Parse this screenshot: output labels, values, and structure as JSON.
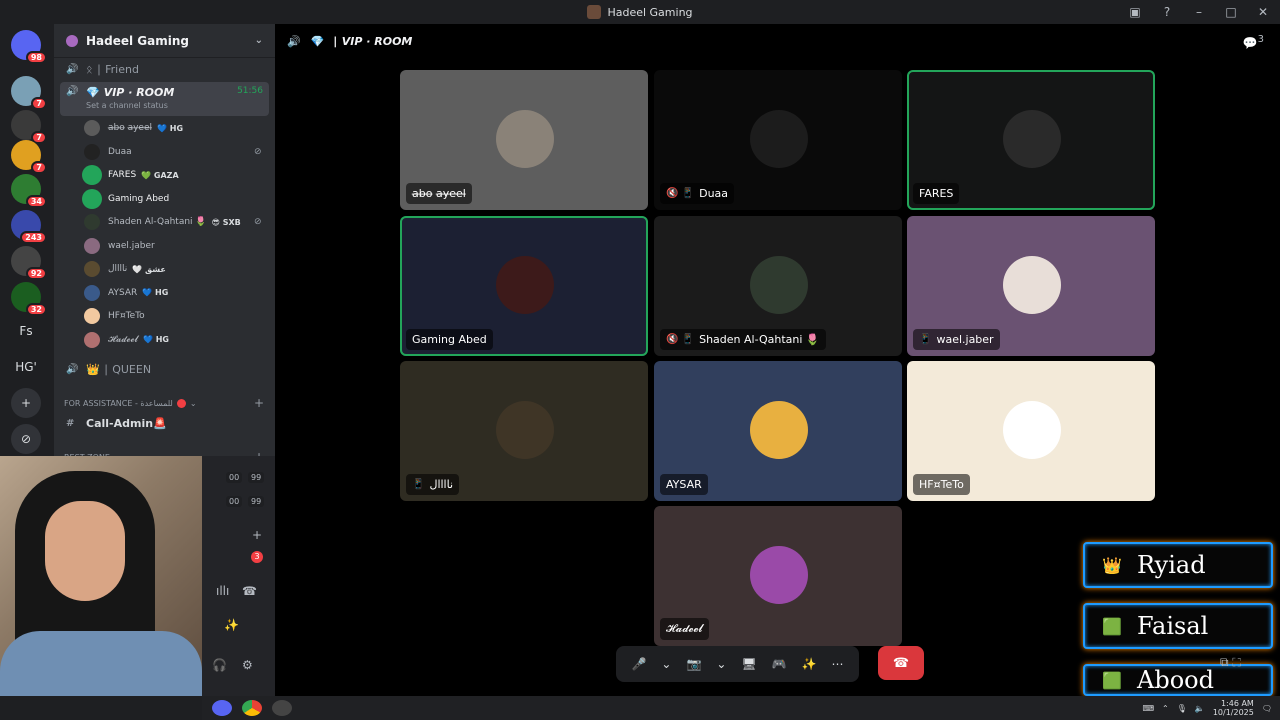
{
  "window": {
    "title": "Hadeel Gaming"
  },
  "servers": [
    {
      "label": "",
      "badge": "98",
      "color": "#5865f2"
    },
    {
      "label": "",
      "badge": "7",
      "color": "#7aa0b5"
    },
    {
      "label": "",
      "badge": "7",
      "color": "#3a3a3a"
    },
    {
      "label": "",
      "badge": "7",
      "color": "#e0a020"
    },
    {
      "label": "",
      "badge": "34",
      "color": "#2e7d32"
    },
    {
      "label": "",
      "badge": "243",
      "color": "#3949ab"
    },
    {
      "label": "",
      "badge": "92",
      "color": "#444"
    },
    {
      "label": "",
      "badge": "32",
      "color": "#1b5e20"
    },
    {
      "label": "Fs",
      "badge": "",
      "color": "transparent"
    },
    {
      "label": "HG'",
      "badge": "",
      "color": "transparent"
    },
    {
      "label": "+",
      "badge": "",
      "color": "#313338"
    },
    {
      "label": "⊘",
      "badge": "",
      "color": "#313338"
    }
  ],
  "sidebar": {
    "server_name": "Hadeel Gaming",
    "channels_top": [
      {
        "name": "Friend",
        "prefix": "ᛟ ∣"
      }
    ],
    "active_channel": {
      "name": "VIP · ROOM",
      "time": "51:56",
      "status": "Set a channel status"
    },
    "voice_users": [
      {
        "name": "a̶b̶o̶ a̶y̶e̶e̶l̶",
        "tag": "💙 HG",
        "muted": false,
        "speaking": false,
        "color": "#5b5b5b"
      },
      {
        "name": "Duaa",
        "tag": "",
        "muted": true,
        "speaking": false,
        "color": "#222"
      },
      {
        "name": "FARES",
        "tag": "💚 GAZA",
        "muted": false,
        "speaking": true,
        "color": "#23a55a"
      },
      {
        "name": "Gaming Abed",
        "tag": "",
        "muted": false,
        "speaking": true,
        "color": "#23a55a"
      },
      {
        "name": "Shaden Al-Qahtani 🌷",
        "tag": "😎 SXB",
        "muted": true,
        "speaking": false,
        "color": "#2f3a2f"
      },
      {
        "name": "wael.jaber",
        "tag": "",
        "muted": false,
        "speaking": false,
        "color": "#8a6a80"
      },
      {
        "name": "ناااال",
        "tag": "🤍 عشق",
        "muted": false,
        "speaking": false,
        "color": "#5a4b30"
      },
      {
        "name": "AYSAR",
        "tag": "💙 HG",
        "muted": false,
        "speaking": false,
        "color": "#3a5a8a"
      },
      {
        "name": "HF¤TeTo",
        "tag": "",
        "muted": false,
        "speaking": false,
        "color": "#f2c9a0"
      },
      {
        "name": "𝓗𝓪𝓭𝓮𝓮𝓵",
        "tag": "💙 HG",
        "muted": false,
        "speaking": false,
        "color": "#b07070"
      }
    ],
    "channel_queen": {
      "name": "QUEEN",
      "prefix": "👑 ∣"
    },
    "category_assist": "FOR ASSISTANCE - للمساعدة",
    "call_admin": "Call-Admin🚨",
    "category_rest": "REST ZONE",
    "counters": [
      "00",
      "99",
      "00",
      "99"
    ],
    "unread_badge": "3"
  },
  "main": {
    "channel_title": "VIP · ROOM",
    "thread_count": "3",
    "tiles": [
      {
        "name": "a̶b̶o̶ a̶y̶e̶e̶l̶",
        "bg": "#5e5e5e",
        "avatar": "#8a8278",
        "icons": "",
        "speaking": false
      },
      {
        "name": "Duaa",
        "bg": "#0a0a0a",
        "avatar": "#1c1c1c",
        "icons": "🔇 📱",
        "speaking": false
      },
      {
        "name": "FARES",
        "bg": "#141515",
        "avatar": "#2a2a2a",
        "icons": "",
        "speaking": true
      },
      {
        "name": "Gaming Abed",
        "bg": "#1c2033",
        "avatar": "#3d1a1a",
        "icons": "",
        "speaking": true
      },
      {
        "name": "Shaden Al-Qahtani 🌷",
        "bg": "#1b1b1b",
        "avatar": "#2f3a2f",
        "icons": "🔇 📱",
        "speaking": false
      },
      {
        "name": "wael.jaber",
        "bg": "#6a5272",
        "avatar": "#e8ded8",
        "icons": "📱",
        "speaking": false
      },
      {
        "name": "ناااال",
        "bg": "#2f2c22",
        "avatar": "#3f3526",
        "icons": "📱",
        "speaking": false
      },
      {
        "name": "AYSAR",
        "bg": "#313f5d",
        "avatar": "#e8b040",
        "icons": "",
        "speaking": false
      },
      {
        "name": "HF¤TeTo",
        "bg": "#f3ead9",
        "avatar": "#ffffff",
        "icons": "",
        "speaking": false
      },
      {
        "name": "𝓗𝓪𝓭𝓮𝓮𝓵",
        "bg": "#3d3132",
        "avatar": "#9a4aa8",
        "icons": "",
        "speaking": false
      }
    ],
    "controls": [
      "🎤",
      "⌄",
      "📷",
      "⌄",
      "🖥",
      "🎮",
      "✨",
      "⋯"
    ],
    "hangup_icon": "☎"
  },
  "overlay_names": [
    {
      "name": "Ryiad",
      "glyph": "👑"
    },
    {
      "name": "Faisal",
      "glyph": "🟩"
    },
    {
      "name": "Abood",
      "glyph": "🟩"
    }
  ],
  "taskbar": {
    "time": "1:46 AM",
    "date": "10/1/2025"
  }
}
